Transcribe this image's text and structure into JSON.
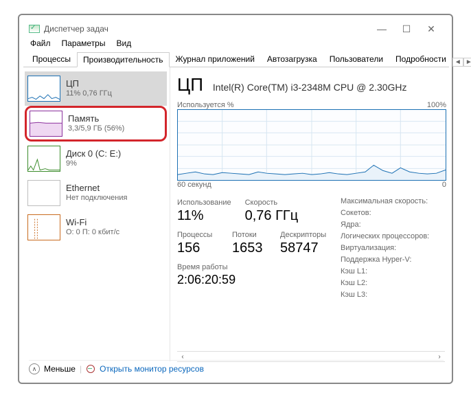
{
  "title": "Диспетчер задач",
  "menu": {
    "file": "Файл",
    "options": "Параметры",
    "view": "Вид"
  },
  "tabs": {
    "processes": "Процессы",
    "performance": "Производительность",
    "apphistory": "Журнал приложений",
    "startup": "Автозагрузка",
    "users": "Пользователи",
    "details": "Подробности"
  },
  "sidebar": {
    "cpu": {
      "name": "ЦП",
      "sub": "11% 0,76 ГГц",
      "color": "#1a6fb3"
    },
    "memory": {
      "name": "Память",
      "sub": "3,3/5,9 ГБ (56%)",
      "color": "#8a2f9c"
    },
    "disk": {
      "name": "Диск 0 (C: E:)",
      "sub": "9%",
      "color": "#3a8b2a"
    },
    "ethernet": {
      "name": "Ethernet",
      "sub": "Нет подключения",
      "color": "#bdbdbd"
    },
    "wifi": {
      "name": "Wi-Fi",
      "sub": "О: 0 П: 0 кбит/с",
      "color": "#c86a1e"
    }
  },
  "detail": {
    "title": "ЦП",
    "model": "Intel(R) Core(TM) i3-2348M CPU @ 2.30GHz",
    "usage_label": "Используется %",
    "usage_max": "100%",
    "x_left": "60 секунд",
    "x_right": "0",
    "stats": {
      "usage": {
        "label": "Использование",
        "value": "11%"
      },
      "speed": {
        "label": "Скорость",
        "value": "0,76 ГГц"
      },
      "processes": {
        "label": "Процессы",
        "value": "156"
      },
      "threads": {
        "label": "Потоки",
        "value": "1653"
      },
      "handles": {
        "label": "Дескрипторы",
        "value": "58747"
      }
    },
    "right": {
      "maxspeed": "Максимальная скорость:",
      "sockets": "Сокетов:",
      "cores": "Ядра:",
      "logical": "Логических процессоров:",
      "virt": "Виртуализация:",
      "hyperv": "Поддержка Hyper-V:",
      "l1": "Кэш L1:",
      "l2": "Кэш L2:",
      "l3": "Кэш L3:"
    },
    "uptime_label": "Время работы",
    "uptime_value": "2:06:20:59"
  },
  "footer": {
    "less": "Меньше",
    "monitor": "Открыть монитор ресурсов"
  },
  "chart_data": {
    "type": "line",
    "title": "Используется %",
    "xlabel": "60 секунд → 0",
    "ylabel": "%",
    "ylim": [
      0,
      100
    ],
    "x": [
      0,
      2,
      4,
      6,
      8,
      10,
      12,
      14,
      16,
      18,
      20,
      22,
      24,
      26,
      28,
      30,
      32,
      34,
      36,
      38,
      40,
      42,
      44,
      46,
      48,
      50,
      52,
      54,
      56,
      58,
      60
    ],
    "values": [
      8,
      10,
      12,
      9,
      8,
      11,
      10,
      9,
      8,
      12,
      10,
      9,
      8,
      9,
      10,
      8,
      9,
      11,
      9,
      8,
      10,
      12,
      22,
      14,
      10,
      18,
      12,
      10,
      9,
      10,
      15
    ],
    "series_color": "#1a6fb3"
  }
}
